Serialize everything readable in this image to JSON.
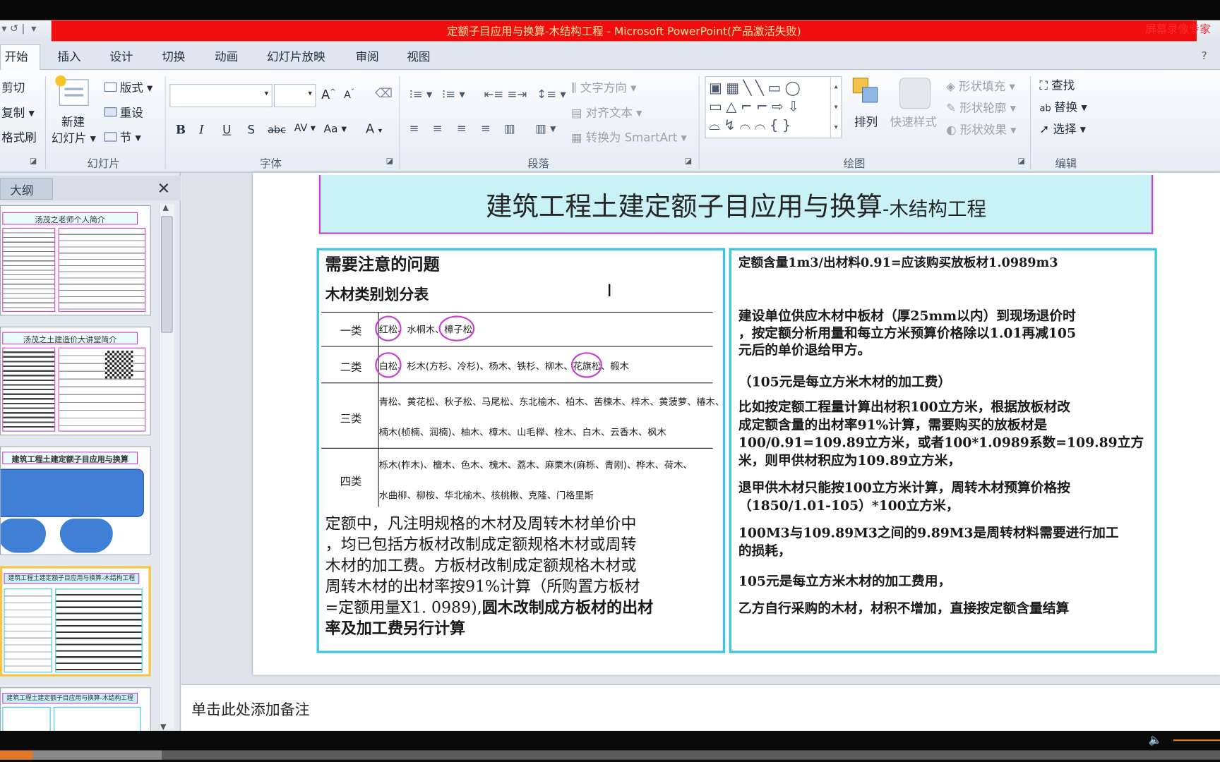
{
  "window": {
    "title": "定额子目应用与换算-木结构工程  -  Microsoft PowerPoint(产品激活失败)",
    "watermark": "屏幕录像专家"
  },
  "ribbon": {
    "tabs": [
      "开始",
      "插入",
      "设计",
      "切换",
      "动画",
      "幻灯片放映",
      "审阅",
      "视图"
    ],
    "clipboard": {
      "cut": "剪切",
      "copy": "复制",
      "format_painter": "格式刷"
    },
    "slides_group": {
      "new_slide_line1": "新建",
      "new_slide_line2": "幻灯片",
      "layout": "版式",
      "reset": "重设",
      "section": "节",
      "label": "幻灯片"
    },
    "font_group": {
      "label": "字体"
    },
    "paragraph_group": {
      "text_direction": "文字方向",
      "align_text": "对齐文本",
      "convert_smartart": "转换为 SmartArt",
      "label": "段落"
    },
    "drawing_group": {
      "arrange": "排列",
      "quick_styles": "快速样式",
      "shape_fill": "形状填充",
      "shape_outline": "形状轮廓",
      "shape_effects": "形状效果",
      "label": "绘图"
    },
    "editing_group": {
      "find": "查找",
      "replace": "替换",
      "select": "选择",
      "label": "编辑"
    }
  },
  "outline_pane": {
    "tab_label": "大纲",
    "thumbs": [
      {
        "title": "汤茂之老师个人简介"
      },
      {
        "title": "汤茂之土建造价大讲堂简介"
      },
      {
        "title": "建筑工程土建定额子目应用与换算"
      },
      {
        "title": "建筑工程土建定额子目应用与换算-木结构工程"
      },
      {
        "title": "建筑工程土建定额子目应用与换算-木结构工程"
      }
    ]
  },
  "slide": {
    "title_main": "建筑工程土建定额子目应用与换算",
    "title_sub": "-木结构工程",
    "left": {
      "heading": "需要注意的问题",
      "table_title": "木材类别划分表",
      "table": [
        {
          "category": "一类",
          "lines": [
            "红松、水桐木、樟子松"
          ]
        },
        {
          "category": "二类",
          "lines": [
            "白松、杉木(方杉、冷杉)、杨木、铁杉、柳木、花旗松、椴木"
          ]
        },
        {
          "category": "三类",
          "lines": [
            "青松、黄花松、秋子松、马尾松、东北榆木、柏木、苦楝木、梓木、黄菠萝、椿木、",
            "楠木(桢楠、润楠)、柚木、樟木、山毛榉、栓木、白木、云香木、枫木"
          ]
        },
        {
          "category": "四类",
          "lines": [
            "栎木(柞木)、檀木、色木、槐木、荔木、麻栗木(麻栎、青刚)、桦木、荷木、",
            "水曲柳、柳桉、华北榆木、核桃楸、克隆、门格里斯"
          ]
        }
      ],
      "para_normal": [
        "定额中，凡注明规格的木材及周转木材单价中",
        "，均已包括方板材改制成定额规格木材或周转",
        "木材的加工费。方板材改制成定额规格木材或",
        "周转木材的出材率按91%计算（所购置方板材",
        "=定额用量X1. 0989),"
      ],
      "para_bold_1": "圆木改制成方板材的出材",
      "para_bold_2": "率及加工费另行计算"
    },
    "right": {
      "p1": "定额含量1m3/出材料0.91=应该购买放板材1.0989m3",
      "p2": [
        "建设单位供应木材中板材（厚25mm以内）到现场退价时",
        "，按定额分析用量和每立方米预算价格除以1.01再减105",
        "元后的单价退给甲方。"
      ],
      "p3": "（105元是每立方米木材的加工费）",
      "p4": [
        "比如按定额工程量计算出材积100立方米，根据放板材改",
        "成定额含量的出材率91%计算，需要购买的放板材是",
        "100/0.91=109.89立方米，或者100*1.0989系数=109.89立方",
        "米，则甲供材积应为109.89立方米，"
      ],
      "p5": [
        "退甲供木材只能按100立方米计算，周转木材预算价格按",
        "（1850/1.01-105）*100立方米，"
      ],
      "p6": [
        "100M3与109.89M3之间的9.89M3是周转材料需要进行加工",
        "的损耗，"
      ],
      "p7": "105元是每立方米木材的加工费用，",
      "p8": "乙方自行采购的木材，材积不增加，直接按定额含量结算"
    }
  },
  "notes": {
    "placeholder": "单击此处添加备注"
  },
  "player": {
    "progress": 0.027,
    "buffered": 0.106
  },
  "colors": {
    "title_bar": "#f00d0d",
    "accent": "#3ac6dc",
    "circle": "#c93fd0",
    "title_fill": "#c9f2f7"
  }
}
